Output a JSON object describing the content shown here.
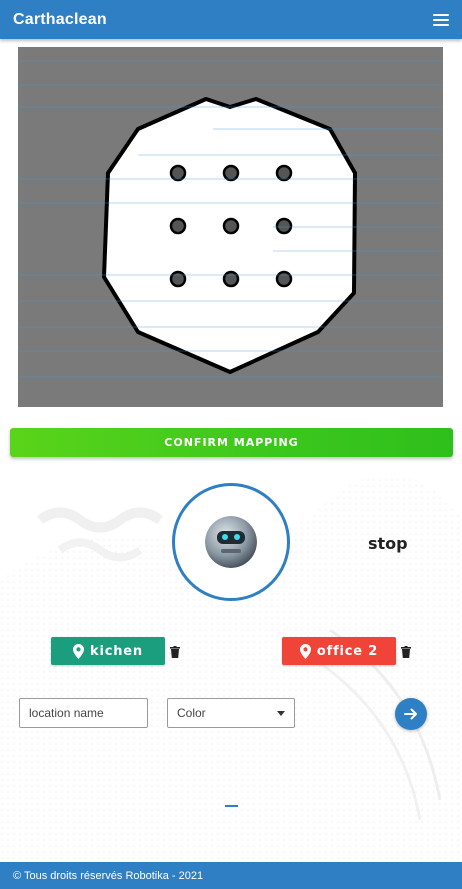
{
  "app": {
    "title": "Carthaclean"
  },
  "header": {
    "menu_icon": "hamburger-menu-icon"
  },
  "map": {
    "background_color": "#7a7a7a",
    "room_color": "#ffffff",
    "obstacle_count": 9
  },
  "actions": {
    "confirm_label": "CONFIRM MAPPING"
  },
  "robot": {
    "avatar_icon": "robot-face-icon",
    "status_label": "stop"
  },
  "locations": [
    {
      "label": "kichen",
      "color": "#1a9e7e",
      "icon": "map-pin-icon",
      "delete_icon": "trash-icon"
    },
    {
      "label": "office 2",
      "color": "#ef4437",
      "icon": "map-pin-icon",
      "delete_icon": "trash-icon"
    }
  ],
  "form": {
    "name_placeholder": "location name",
    "color_placeholder": "Color",
    "submit_icon": "arrow-right-icon"
  },
  "footer": {
    "text": "© Tous droits réservés Robotika - 2021"
  },
  "colors": {
    "primary": "#2f7fc4",
    "confirm": "#3cc71d"
  }
}
